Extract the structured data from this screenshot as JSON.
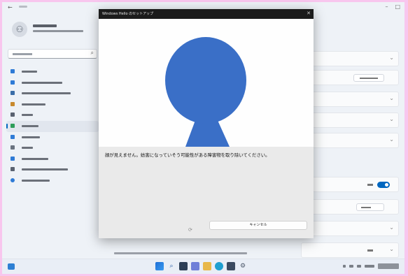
{
  "dialog": {
    "title": "Windows Hello のセットアップ",
    "message": "顔が見えません。妨害になっていそう可能性がある障害物を取り除いてください。",
    "cancel_label": "キャンセル",
    "close_glyph": "✕"
  },
  "face_color": "#3a6fc7",
  "accent": "#0067c0"
}
